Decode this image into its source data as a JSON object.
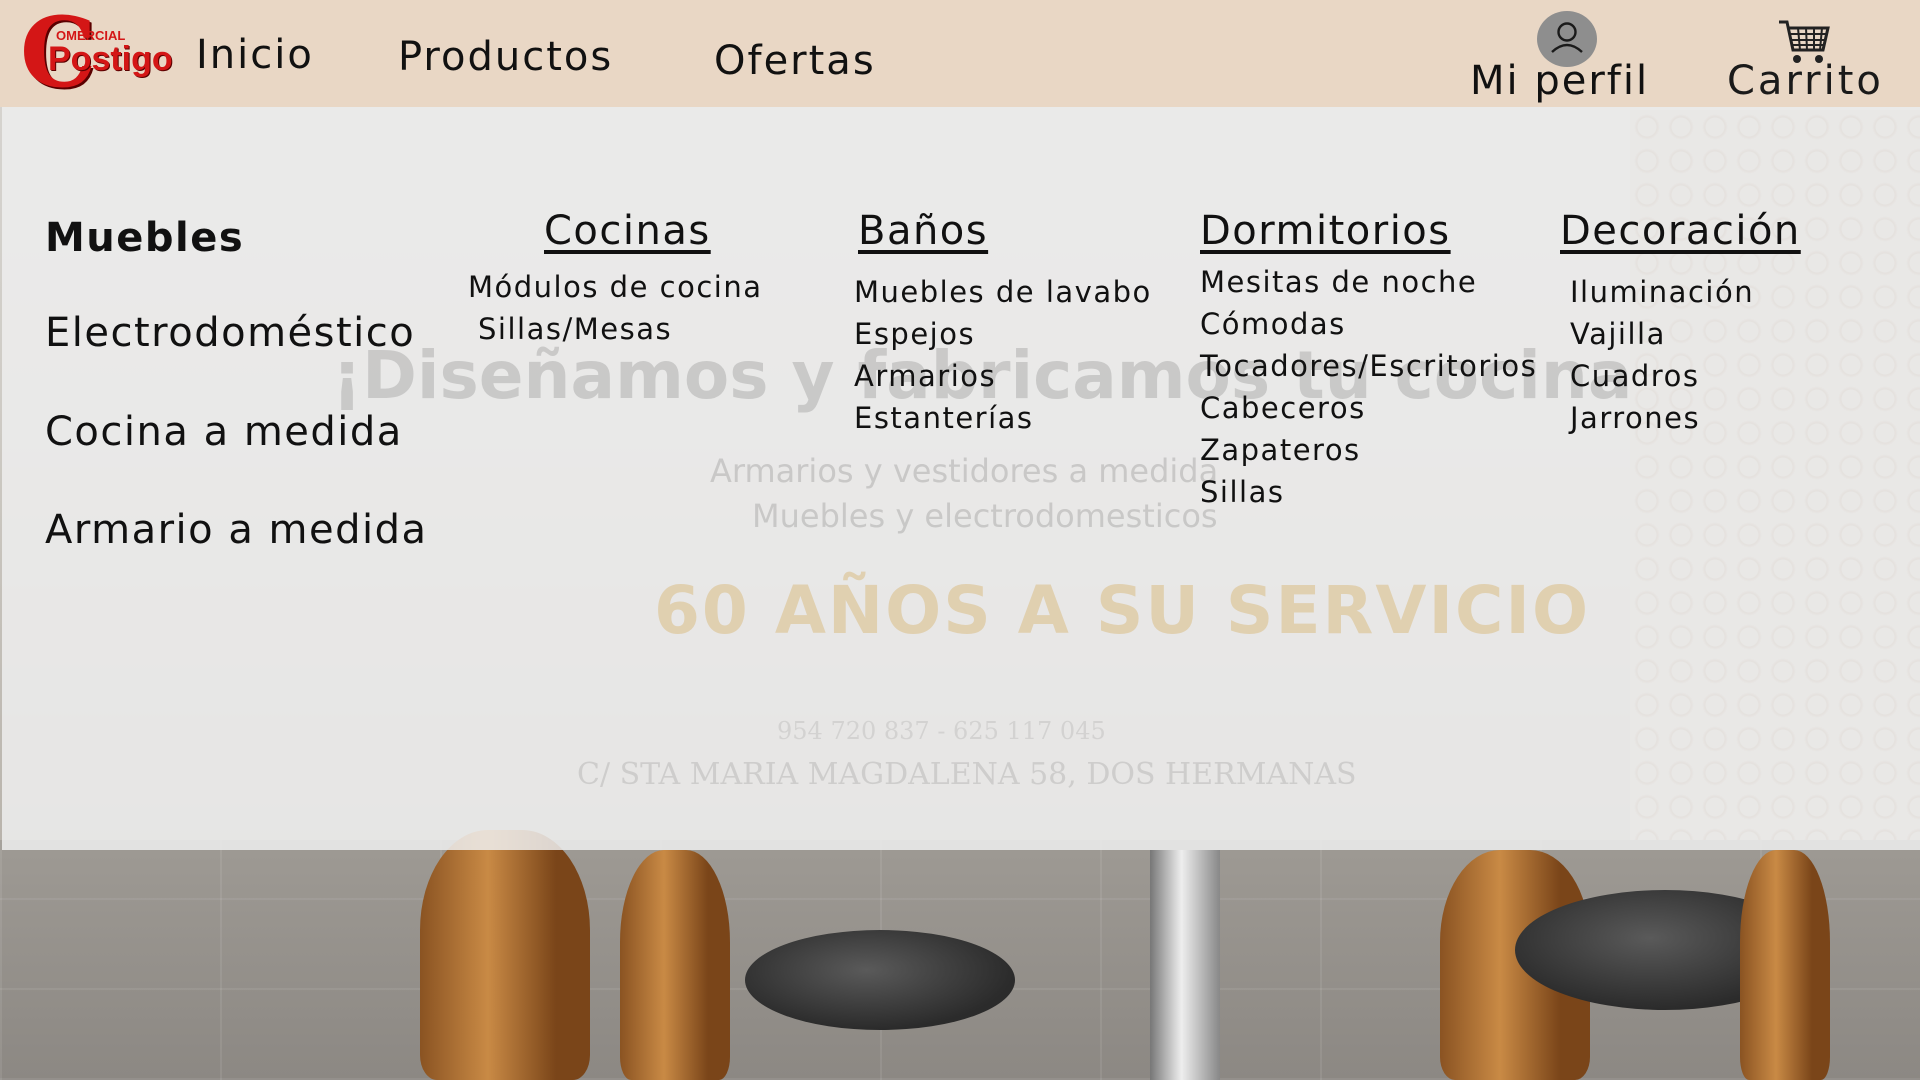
{
  "brand": {
    "logo_initial": "C",
    "logo_small": "OMERCIAL",
    "logo_main": "Postigo",
    "color": "#d41616"
  },
  "header": {
    "background": "#e9d7c5",
    "nav": {
      "home": "Inicio",
      "products": "Productos",
      "offers": "Ofertas"
    },
    "profile": {
      "label": "Mi perfil",
      "icon": "user-avatar-icon"
    },
    "cart": {
      "label": "Carrito",
      "icon": "shopping-cart-icon"
    }
  },
  "menu": {
    "categories": [
      "Muebles",
      "Electrodoméstico",
      "Cocina a medida",
      "Armario a medida"
    ],
    "active_category": "Muebles",
    "columns": [
      {
        "title": "Cocinas",
        "items": [
          "Módulos de cocina",
          "Sillas/Mesas"
        ]
      },
      {
        "title": "Baños",
        "items": [
          "Muebles de lavabo",
          "Espejos",
          "Armarios",
          "Estanterías"
        ]
      },
      {
        "title": "Dormitorios",
        "items": [
          "Mesitas de noche",
          "Cómodas",
          "Tocadores/Escritorios",
          "Cabeceros",
          "Zapateros",
          "Sillas"
        ]
      },
      {
        "title": "Decoración",
        "items": [
          "Iluminación",
          "Vajilla",
          "Cuadros",
          "Jarrones"
        ]
      }
    ]
  },
  "hero": {
    "title": "¡Diseñamos y fabricamos tu cocina",
    "line1": "Armarios y vestidores a medida",
    "line2": "Muebles y electrodomesticos",
    "years": "60 AÑOS A SU SERVICIO",
    "phones": "954 720 837 - 625 117 045",
    "address": "C/ STA MARIA MAGDALENA 58, DOS HERMANAS"
  }
}
